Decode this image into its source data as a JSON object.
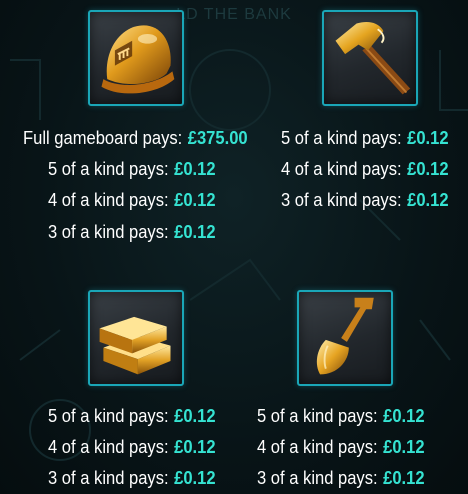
{
  "watermark": "LD THE BANK",
  "symbols": [
    {
      "icon": "gold-hard-hat-icon",
      "pays": [
        {
          "label": "Full gameboard pays:",
          "value": "£375.00"
        },
        {
          "label": "5 of a kind pays:",
          "value": "£0.12"
        },
        {
          "label": "4 of a kind pays:",
          "value": "£0.12"
        },
        {
          "label": "3 of a kind pays:",
          "value": "£0.12"
        }
      ]
    },
    {
      "icon": "gold-hammer-icon",
      "pays": [
        {
          "label": "5 of a kind pays:",
          "value": "£0.12"
        },
        {
          "label": "4 of a kind pays:",
          "value": "£0.12"
        },
        {
          "label": "3 of a kind pays:",
          "value": "£0.12"
        }
      ]
    },
    {
      "icon": "gold-bars-icon",
      "pays": [
        {
          "label": "5 of a kind pays:",
          "value": "£0.12"
        },
        {
          "label": "4 of a kind pays:",
          "value": "£0.12"
        },
        {
          "label": "3 of a kind pays:",
          "value": "£0.12"
        }
      ]
    },
    {
      "icon": "gold-shovel-icon",
      "pays": [
        {
          "label": "5 of a kind pays:",
          "value": "£0.12"
        },
        {
          "label": "4 of a kind pays:",
          "value": "£0.12"
        },
        {
          "label": "3 of a kind pays:",
          "value": "£0.12"
        }
      ]
    }
  ],
  "colors": {
    "frame": "#1aa6b7",
    "value": "#35e3d2",
    "label": "#ffffff",
    "gold": "#e8a21c"
  }
}
